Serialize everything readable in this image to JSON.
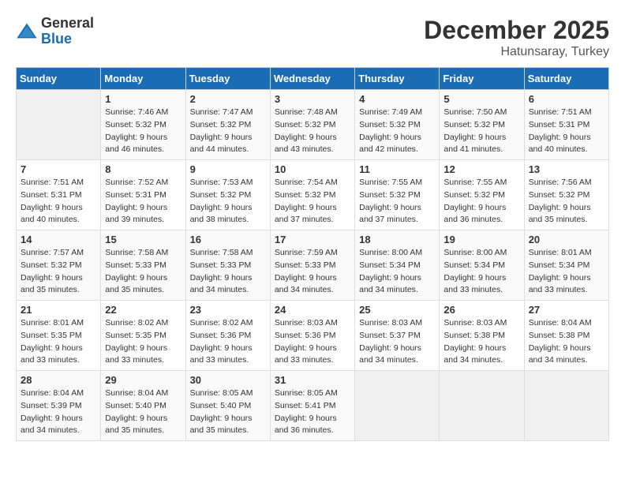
{
  "logo": {
    "text_general": "General",
    "text_blue": "Blue"
  },
  "header": {
    "month": "December 2025",
    "location": "Hatunsaray, Turkey"
  },
  "weekdays": [
    "Sunday",
    "Monday",
    "Tuesday",
    "Wednesday",
    "Thursday",
    "Friday",
    "Saturday"
  ],
  "weeks": [
    [
      {
        "day": "",
        "sunrise": "",
        "sunset": "",
        "daylight": ""
      },
      {
        "day": "1",
        "sunrise": "Sunrise: 7:46 AM",
        "sunset": "Sunset: 5:32 PM",
        "daylight": "Daylight: 9 hours and 46 minutes."
      },
      {
        "day": "2",
        "sunrise": "Sunrise: 7:47 AM",
        "sunset": "Sunset: 5:32 PM",
        "daylight": "Daylight: 9 hours and 44 minutes."
      },
      {
        "day": "3",
        "sunrise": "Sunrise: 7:48 AM",
        "sunset": "Sunset: 5:32 PM",
        "daylight": "Daylight: 9 hours and 43 minutes."
      },
      {
        "day": "4",
        "sunrise": "Sunrise: 7:49 AM",
        "sunset": "Sunset: 5:32 PM",
        "daylight": "Daylight: 9 hours and 42 minutes."
      },
      {
        "day": "5",
        "sunrise": "Sunrise: 7:50 AM",
        "sunset": "Sunset: 5:32 PM",
        "daylight": "Daylight: 9 hours and 41 minutes."
      },
      {
        "day": "6",
        "sunrise": "Sunrise: 7:51 AM",
        "sunset": "Sunset: 5:31 PM",
        "daylight": "Daylight: 9 hours and 40 minutes."
      }
    ],
    [
      {
        "day": "7",
        "sunrise": "Sunrise: 7:51 AM",
        "sunset": "Sunset: 5:31 PM",
        "daylight": "Daylight: 9 hours and 40 minutes."
      },
      {
        "day": "8",
        "sunrise": "Sunrise: 7:52 AM",
        "sunset": "Sunset: 5:31 PM",
        "daylight": "Daylight: 9 hours and 39 minutes."
      },
      {
        "day": "9",
        "sunrise": "Sunrise: 7:53 AM",
        "sunset": "Sunset: 5:32 PM",
        "daylight": "Daylight: 9 hours and 38 minutes."
      },
      {
        "day": "10",
        "sunrise": "Sunrise: 7:54 AM",
        "sunset": "Sunset: 5:32 PM",
        "daylight": "Daylight: 9 hours and 37 minutes."
      },
      {
        "day": "11",
        "sunrise": "Sunrise: 7:55 AM",
        "sunset": "Sunset: 5:32 PM",
        "daylight": "Daylight: 9 hours and 37 minutes."
      },
      {
        "day": "12",
        "sunrise": "Sunrise: 7:55 AM",
        "sunset": "Sunset: 5:32 PM",
        "daylight": "Daylight: 9 hours and 36 minutes."
      },
      {
        "day": "13",
        "sunrise": "Sunrise: 7:56 AM",
        "sunset": "Sunset: 5:32 PM",
        "daylight": "Daylight: 9 hours and 35 minutes."
      }
    ],
    [
      {
        "day": "14",
        "sunrise": "Sunrise: 7:57 AM",
        "sunset": "Sunset: 5:32 PM",
        "daylight": "Daylight: 9 hours and 35 minutes."
      },
      {
        "day": "15",
        "sunrise": "Sunrise: 7:58 AM",
        "sunset": "Sunset: 5:33 PM",
        "daylight": "Daylight: 9 hours and 35 minutes."
      },
      {
        "day": "16",
        "sunrise": "Sunrise: 7:58 AM",
        "sunset": "Sunset: 5:33 PM",
        "daylight": "Daylight: 9 hours and 34 minutes."
      },
      {
        "day": "17",
        "sunrise": "Sunrise: 7:59 AM",
        "sunset": "Sunset: 5:33 PM",
        "daylight": "Daylight: 9 hours and 34 minutes."
      },
      {
        "day": "18",
        "sunrise": "Sunrise: 8:00 AM",
        "sunset": "Sunset: 5:34 PM",
        "daylight": "Daylight: 9 hours and 34 minutes."
      },
      {
        "day": "19",
        "sunrise": "Sunrise: 8:00 AM",
        "sunset": "Sunset: 5:34 PM",
        "daylight": "Daylight: 9 hours and 33 minutes."
      },
      {
        "day": "20",
        "sunrise": "Sunrise: 8:01 AM",
        "sunset": "Sunset: 5:34 PM",
        "daylight": "Daylight: 9 hours and 33 minutes."
      }
    ],
    [
      {
        "day": "21",
        "sunrise": "Sunrise: 8:01 AM",
        "sunset": "Sunset: 5:35 PM",
        "daylight": "Daylight: 9 hours and 33 minutes."
      },
      {
        "day": "22",
        "sunrise": "Sunrise: 8:02 AM",
        "sunset": "Sunset: 5:35 PM",
        "daylight": "Daylight: 9 hours and 33 minutes."
      },
      {
        "day": "23",
        "sunrise": "Sunrise: 8:02 AM",
        "sunset": "Sunset: 5:36 PM",
        "daylight": "Daylight: 9 hours and 33 minutes."
      },
      {
        "day": "24",
        "sunrise": "Sunrise: 8:03 AM",
        "sunset": "Sunset: 5:36 PM",
        "daylight": "Daylight: 9 hours and 33 minutes."
      },
      {
        "day": "25",
        "sunrise": "Sunrise: 8:03 AM",
        "sunset": "Sunset: 5:37 PM",
        "daylight": "Daylight: 9 hours and 34 minutes."
      },
      {
        "day": "26",
        "sunrise": "Sunrise: 8:03 AM",
        "sunset": "Sunset: 5:38 PM",
        "daylight": "Daylight: 9 hours and 34 minutes."
      },
      {
        "day": "27",
        "sunrise": "Sunrise: 8:04 AM",
        "sunset": "Sunset: 5:38 PM",
        "daylight": "Daylight: 9 hours and 34 minutes."
      }
    ],
    [
      {
        "day": "28",
        "sunrise": "Sunrise: 8:04 AM",
        "sunset": "Sunset: 5:39 PM",
        "daylight": "Daylight: 9 hours and 34 minutes."
      },
      {
        "day": "29",
        "sunrise": "Sunrise: 8:04 AM",
        "sunset": "Sunset: 5:40 PM",
        "daylight": "Daylight: 9 hours and 35 minutes."
      },
      {
        "day": "30",
        "sunrise": "Sunrise: 8:05 AM",
        "sunset": "Sunset: 5:40 PM",
        "daylight": "Daylight: 9 hours and 35 minutes."
      },
      {
        "day": "31",
        "sunrise": "Sunrise: 8:05 AM",
        "sunset": "Sunset: 5:41 PM",
        "daylight": "Daylight: 9 hours and 36 minutes."
      },
      {
        "day": "",
        "sunrise": "",
        "sunset": "",
        "daylight": ""
      },
      {
        "day": "",
        "sunrise": "",
        "sunset": "",
        "daylight": ""
      },
      {
        "day": "",
        "sunrise": "",
        "sunset": "",
        "daylight": ""
      }
    ]
  ]
}
